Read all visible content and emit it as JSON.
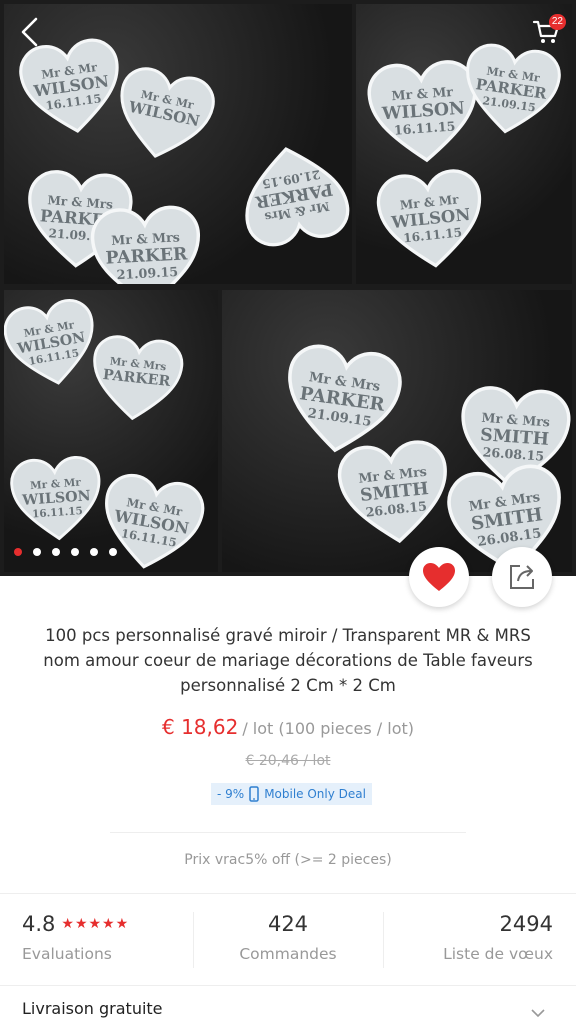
{
  "gallery": {
    "photo_hearts": {
      "p1": [
        [
          "Mr & Mr",
          "WILSON",
          "16.11.15"
        ],
        [
          "Mr & Mrs",
          "PARKER",
          "21.09.15"
        ],
        [
          "Mr & Mr",
          "WILSON",
          ""
        ],
        [
          "Mr & Mrs",
          "PARKER",
          "21.09.15"
        ],
        [
          "Mr & Mrs",
          "PARKER",
          "21.09.15"
        ]
      ],
      "p2": [
        [
          "Mr & Mr",
          "WILSON",
          "16.11.15"
        ],
        [
          "Mr & Mr",
          "PARKER",
          "21.09.15"
        ],
        [
          "Mr & Mr",
          "WILSON",
          "16.11.15"
        ]
      ],
      "p3": [
        [
          "Mr & Mr",
          "WILSON",
          "16.11.15"
        ],
        [
          "Mr & Mrs",
          "PARKER",
          ""
        ],
        [
          "Mr & Mr",
          "WILSON",
          "16.11.15"
        ],
        [
          "Mr & Mr",
          "WILSON",
          "16.11.15"
        ]
      ],
      "p4": [
        [
          "Mr & Mrs",
          "PARKER",
          "21.09.15"
        ],
        [
          "Mr & Mrs",
          "SMITH",
          "26.08.15"
        ],
        [
          "Mr & Mrs",
          "SMITH",
          "26.08.15"
        ],
        [
          "Mr & Mrs",
          "SMITH",
          "26.08.15"
        ]
      ]
    },
    "cart_count": "22",
    "slide_count": 6,
    "active_slide": 0
  },
  "product": {
    "title": "100 pcs personnalisé gravé miroir / Transparent MR & MRS nom amour coeur de mariage décorations de Table faveurs personnalisé 2 Cm * 2 Cm",
    "price": "€ 18,62",
    "per_lot": "/ lot (100 pieces / lot)",
    "old_price": "€ 20,46 / lot",
    "discount": "- 9%",
    "deal_label": "Mobile Only Deal",
    "bulk_price": "Prix vrac5% off (>= 2 pieces)"
  },
  "stats": {
    "rating": "4.8",
    "rating_stars": "★★★★★",
    "rating_label": "Evaluations",
    "orders": "424",
    "orders_label": "Commandes",
    "wishlist": "2494",
    "wishlist_label": "Liste de vœux"
  },
  "shipping": {
    "label": "Livraison gratuite"
  },
  "colors": {
    "accent": "#e62e2e",
    "deal_blue": "#2f7fd0"
  }
}
